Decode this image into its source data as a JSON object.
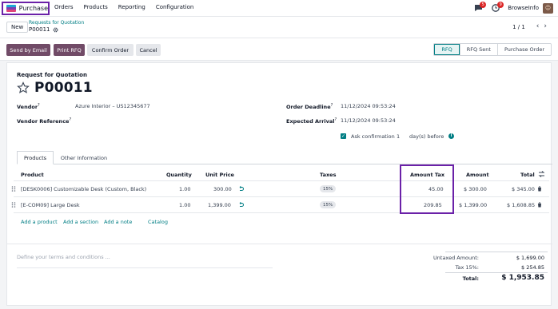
{
  "navbar": {
    "app_name": "Purchase",
    "menu": [
      "Orders",
      "Products",
      "Reporting",
      "Configuration"
    ],
    "messages_badge": "5",
    "activities_badge": "9",
    "company": "BrowseInfo"
  },
  "control": {
    "new_label": "New",
    "breadcrumb_parent": "Requests for Quotation",
    "breadcrumb_current": "P00011",
    "pager": "1 / 1"
  },
  "actions": {
    "send_email": "Send by Email",
    "print_rfq": "Print RFQ",
    "confirm_order": "Confirm Order",
    "cancel": "Cancel"
  },
  "statusbar": [
    "RFQ",
    "RFQ Sent",
    "Purchase Order"
  ],
  "form": {
    "doc_type": "Request for Quotation",
    "title": "P00011",
    "vendor_label": "Vendor",
    "vendor_value": "Azure Interior – US12345677",
    "vendor_ref_label": "Vendor Reference",
    "order_deadline_label": "Order Deadline",
    "order_deadline_value": "11/12/2024 09:53:24",
    "expected_arrival_label": "Expected Arrival",
    "expected_arrival_value": "11/12/2024 09:53:24",
    "ask_confirmation_label": "Ask confirmation",
    "ask_confirmation_days": "1",
    "ask_confirmation_suffix": "day(s) before"
  },
  "tabs": [
    "Products",
    "Other Information"
  ],
  "table": {
    "headers": {
      "product": "Product",
      "quantity": "Quantity",
      "unit_price": "Unit Price",
      "taxes": "Taxes",
      "amount_tax": "Amount Tax",
      "amount": "Amount",
      "total": "Total"
    },
    "rows": [
      {
        "product": "[DESK0006] Customizable Desk (Custom, Black)",
        "quantity": "1.00",
        "unit_price": "300.00",
        "tax": "15%",
        "amount_tax": "45.00",
        "amount": "$ 300.00",
        "total": "$ 345.00"
      },
      {
        "product": "[E-COM09] Large Desk",
        "quantity": "1.00",
        "unit_price": "1,399.00",
        "tax": "15%",
        "amount_tax": "209.85",
        "amount": "$ 1,399.00",
        "total": "$ 1,608.85"
      }
    ],
    "links": [
      "Add a product",
      "Add a section",
      "Add a note",
      "Catalog"
    ]
  },
  "footer": {
    "terms_placeholder": "Define your terms and conditions ...",
    "untaxed_label": "Untaxed Amount:",
    "untaxed_value": "$ 1,699.00",
    "tax_label": "Tax 15%:",
    "tax_value": "$ 254.85",
    "total_label": "Total:",
    "total_value": "$ 1,953.85"
  },
  "colors": {
    "brand": "#714b67",
    "accent": "#017e84",
    "highlight": "#6b21a8"
  }
}
